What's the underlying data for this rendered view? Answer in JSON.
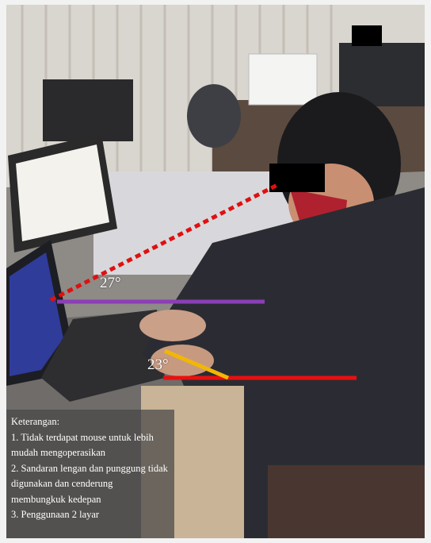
{
  "annotations": {
    "angle_upper": "27°",
    "angle_lower": "23°",
    "colors": {
      "neck_line": "#e01010",
      "horizontal_upper": "#8a3fb5",
      "horizontal_lower": "#e81010",
      "forearm_line": "#f2b705"
    }
  },
  "notes": {
    "title": "Keterangan:",
    "items": [
      "1. Tidak terdapat mouse untuk lebih mudah mengoperasikan",
      "2. Sandaran lengan dan punggung tidak digunakan dan cenderung membungkuk kedepan",
      "3. Penggunaan 2 layar"
    ]
  }
}
